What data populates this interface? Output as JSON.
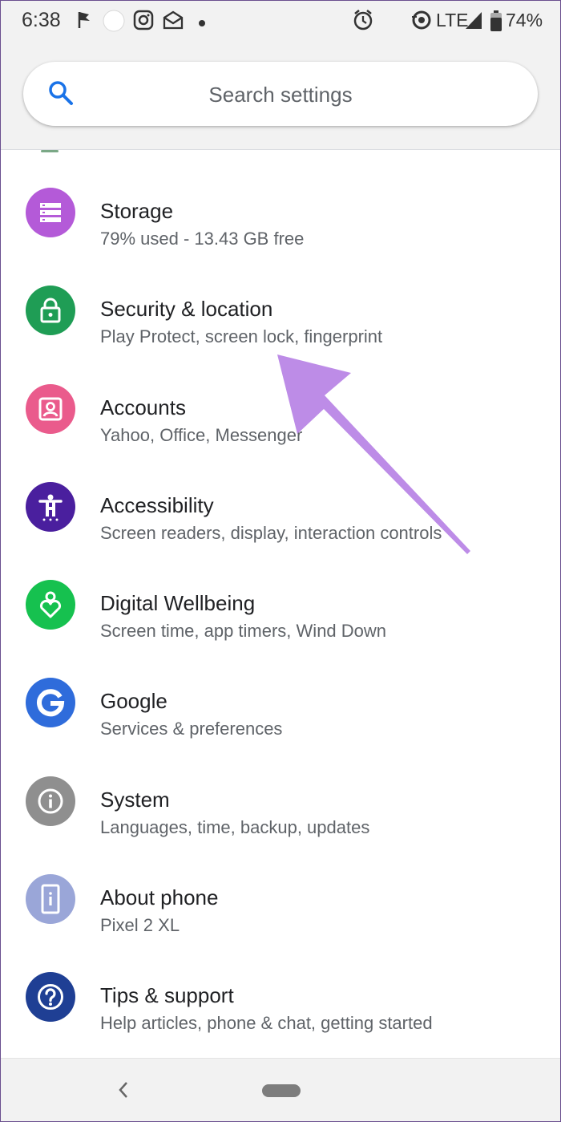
{
  "status_bar": {
    "time": "6:38",
    "network": "LTE",
    "battery": "74%"
  },
  "search": {
    "placeholder": "Search settings"
  },
  "settings_items": [
    {
      "title": "Storage",
      "subtitle": "79% used - 13.43 GB free",
      "icon": "storage-icon",
      "color": "#b45ad8"
    },
    {
      "title": "Security & location",
      "subtitle": "Play Protect, screen lock, fingerprint",
      "icon": "lock-icon",
      "color": "#1f9d55"
    },
    {
      "title": "Accounts",
      "subtitle": "Yahoo, Office, Messenger",
      "icon": "account-box-icon",
      "color": "#ea5b8c"
    },
    {
      "title": "Accessibility",
      "subtitle": "Screen readers, display, interaction controls",
      "icon": "accessibility-icon",
      "color": "#4a1f9e"
    },
    {
      "title": "Digital Wellbeing",
      "subtitle": "Screen time, app timers, Wind Down",
      "icon": "wellbeing-heart-icon",
      "color": "#16c14f"
    },
    {
      "title": "Google",
      "subtitle": "Services & preferences",
      "icon": "google-g-icon",
      "color": "#2f6cdb"
    },
    {
      "title": "System",
      "subtitle": "Languages, time, backup, updates",
      "icon": "info-icon",
      "color": "#8f8f8f"
    },
    {
      "title": "About phone",
      "subtitle": "Pixel 2 XL",
      "icon": "phone-info-icon",
      "color": "#9aa6d8"
    },
    {
      "title": "Tips & support",
      "subtitle": "Help articles, phone & chat, getting started",
      "icon": "help-icon",
      "color": "#1f3f94"
    }
  ],
  "annotation": {
    "arrow_color": "#b986e6",
    "points_to": "Security & location"
  },
  "nav_bar": {
    "back_icon": "back-chevron-icon",
    "home_icon": "home-pill-icon"
  }
}
